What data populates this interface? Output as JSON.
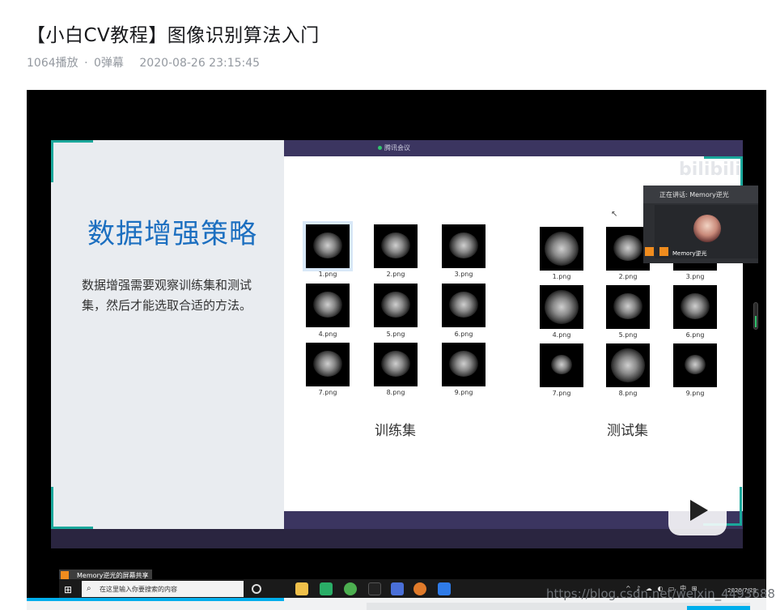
{
  "page": {
    "title": "【小白CV教程】图像识别算法入门",
    "views": "1064播放",
    "separator": "·",
    "danmaku": "0弹幕",
    "datetime": "2020-08-26 23:15:45"
  },
  "slide": {
    "heading": "数据增强策略",
    "body": "数据增强需要观察训练集和测试集，然后才能选取合适的方法。",
    "train_label": "训练集",
    "test_label": "测试集",
    "train_images": [
      "1.png",
      "2.png",
      "3.png",
      "4.png",
      "5.png",
      "6.png",
      "7.png",
      "8.png",
      "9.png"
    ],
    "test_images": [
      "1.png",
      "2.png",
      "3.png",
      "4.png",
      "5.png",
      "6.png",
      "7.png",
      "8.png",
      "9.png"
    ]
  },
  "meeting": {
    "app_label": "腾讯会议",
    "speaking_label": "正在讲话: Memory逆光",
    "camera_name": "Memory逆光",
    "share_label": "Memory逆光的屏幕共享"
  },
  "taskbar": {
    "search_placeholder": "在这里输入你要搜索的内容",
    "date": "2020/7/29",
    "tray": "^ ♪ ☁ ◐ ▭ 中 ⊞"
  },
  "watermarks": {
    "bilibili": "bilibili",
    "csdn": "https://blog.csdn.net/weixin_44936889"
  },
  "colors": {
    "accent_blue": "#00aeec",
    "slide_heading": "#1c6fc0",
    "corner_teal": "#1aa79b",
    "meeting_purple": "#3b3560"
  },
  "icons": {
    "start": "windows-start-icon",
    "search": "search-icon",
    "play": "play-icon"
  }
}
